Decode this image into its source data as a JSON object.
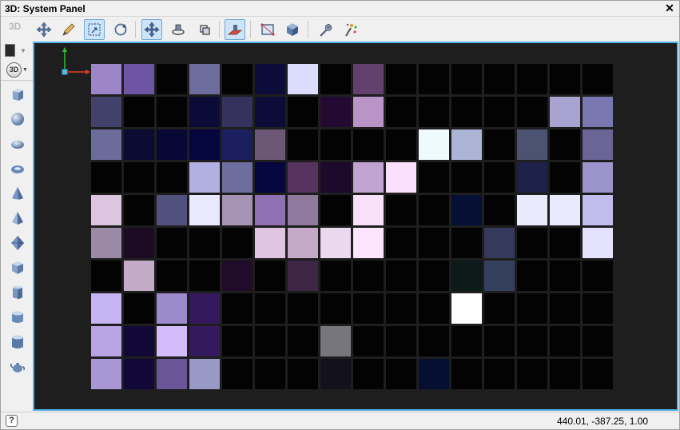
{
  "window": {
    "title": "3D: System Panel",
    "close_glyph": "✕"
  },
  "toolbar": {
    "mode_label": "3D",
    "buttons": [
      {
        "name": "move-object-button",
        "icon": "move-arrows-icon",
        "active": false
      },
      {
        "name": "draw-button",
        "icon": "pencil-icon",
        "active": false
      },
      {
        "name": "select-region-button",
        "icon": "select-region-icon",
        "active": true
      },
      {
        "name": "rotate-button",
        "icon": "rotate-icon",
        "active": false
      },
      {
        "name": "pan-view-button",
        "icon": "pan-arrows-icon",
        "active": true
      },
      {
        "name": "orbit-camera-button",
        "icon": "orbit-icon",
        "active": false
      },
      {
        "name": "roll-view-button",
        "icon": "roll-icon",
        "active": false
      },
      {
        "name": "ground-plane-button",
        "icon": "ground-plane-icon",
        "active": true
      },
      {
        "name": "bounding-box-button",
        "icon": "bounding-box-icon",
        "active": false
      },
      {
        "name": "shaded-cube-button",
        "icon": "shaded-cube-icon",
        "active": false
      },
      {
        "name": "settings-button",
        "icon": "wrench-icon",
        "active": false
      },
      {
        "name": "effects-button",
        "icon": "magic-wand-icon",
        "active": false
      }
    ]
  },
  "left_toolbar": {
    "color_swatch": "#2a2a2a",
    "view_mode_label": "3D",
    "shapes": [
      "cube-icon",
      "sphere-icon",
      "ellipsoid-icon",
      "torus-icon",
      "cone-icon",
      "pyramid-icon",
      "octahedron-icon",
      "prism-icon",
      "hex-cylinder-icon",
      "cylinder-icon",
      "tall-cylinder-icon",
      "teapot-icon"
    ]
  },
  "viewport": {
    "background": "#1e1e1e",
    "axis_colors": {
      "x": "#e83a2a",
      "y": "#2cc12c",
      "origin": "#5ab8d6"
    },
    "grid": {
      "columns": 16,
      "rows": [
        [
          "#9c85c9",
          "#6e55a3",
          "#030303",
          "#6d6d9d",
          "#030303",
          "#0c0c38",
          "#dcdcfc",
          "#030303",
          "#63416e",
          "#030303",
          "#030303",
          "#030303",
          "#030303",
          "#030303",
          "#030303",
          "#030303"
        ],
        [
          "#42416c",
          "#030303",
          "#030303",
          "#0b0b38",
          "#35335e",
          "#0c0c38",
          "#030303",
          "#240a33",
          "#b895c6",
          "#030303",
          "#030303",
          "#030303",
          "#030303",
          "#030303",
          "#a8a3d0",
          "#7a77b0"
        ],
        [
          "#6c6c9c",
          "#0a0a33",
          "#080836",
          "#06063e",
          "#1c1f5f",
          "#6c5777",
          "#030303",
          "#030303",
          "#030303",
          "#030303",
          "#eefafd",
          "#adb5d7",
          "#030303",
          "#4c5271",
          "#030303",
          "#6a6596"
        ],
        [
          "#030303",
          "#030303",
          "#030303",
          "#b2b0e3",
          "#6d6e9e",
          "#06063e",
          "#56325e",
          "#1c0a2c",
          "#c3a3d1",
          "#fce0fb",
          "#030303",
          "#030303",
          "#030303",
          "#1d2048",
          "#030303",
          "#9b95cb"
        ],
        [
          "#ddc5df",
          "#030303",
          "#50517d",
          "#ebe9fe",
          "#a693b4",
          "#8f70b1",
          "#8f7a9d",
          "#030303",
          "#f8e0f9",
          "#030303",
          "#030303",
          "#061035",
          "#030303",
          "#e9eafc",
          "#e9eafb",
          "#c0bcec"
        ],
        [
          "#9b8aa5",
          "#1c0a22",
          "#030303",
          "#030303",
          "#030303",
          "#dfc5e2",
          "#c5aac8",
          "#ebd8ef",
          "#fde5fd",
          "#030303",
          "#030303",
          "#030303",
          "#35395c",
          "#030303",
          "#030303",
          "#e4e2fd"
        ],
        [
          "#030303",
          "#c3aac6",
          "#030303",
          "#030303",
          "#200c2a",
          "#030303",
          "#3e2647",
          "#030303",
          "#030303",
          "#030303",
          "#030303",
          "#0c1a1a",
          "#35405e",
          "#030303",
          "#030303",
          "#030303"
        ],
        [
          "#c6b3f1",
          "#030303",
          "#9d8acd",
          "#35195e",
          "#030303",
          "#030303",
          "#030303",
          "#030303",
          "#030303",
          "#030303",
          "#030303",
          "#ffffff",
          "#030303",
          "#030303",
          "#030303",
          "#030303"
        ],
        [
          "#b9a4e3",
          "#110838",
          "#d4bbf9",
          "#35195e",
          "#030303",
          "#030303",
          "#030303",
          "#77767d",
          "#030303",
          "#030303",
          "#030303",
          "#030303",
          "#030303",
          "#030303",
          "#030303",
          "#030303"
        ],
        [
          "#a897d3",
          "#110838",
          "#6b5599",
          "#9899c5",
          "#030303",
          "#030303",
          "#030303",
          "#13121c",
          "#030303",
          "#030303",
          "#050f31",
          "#030303",
          "#030303",
          "#030303",
          "#030303",
          "#030303"
        ]
      ]
    }
  },
  "status": {
    "help_label": "?",
    "coordinates": "440.01, -387.25, 1.00"
  }
}
